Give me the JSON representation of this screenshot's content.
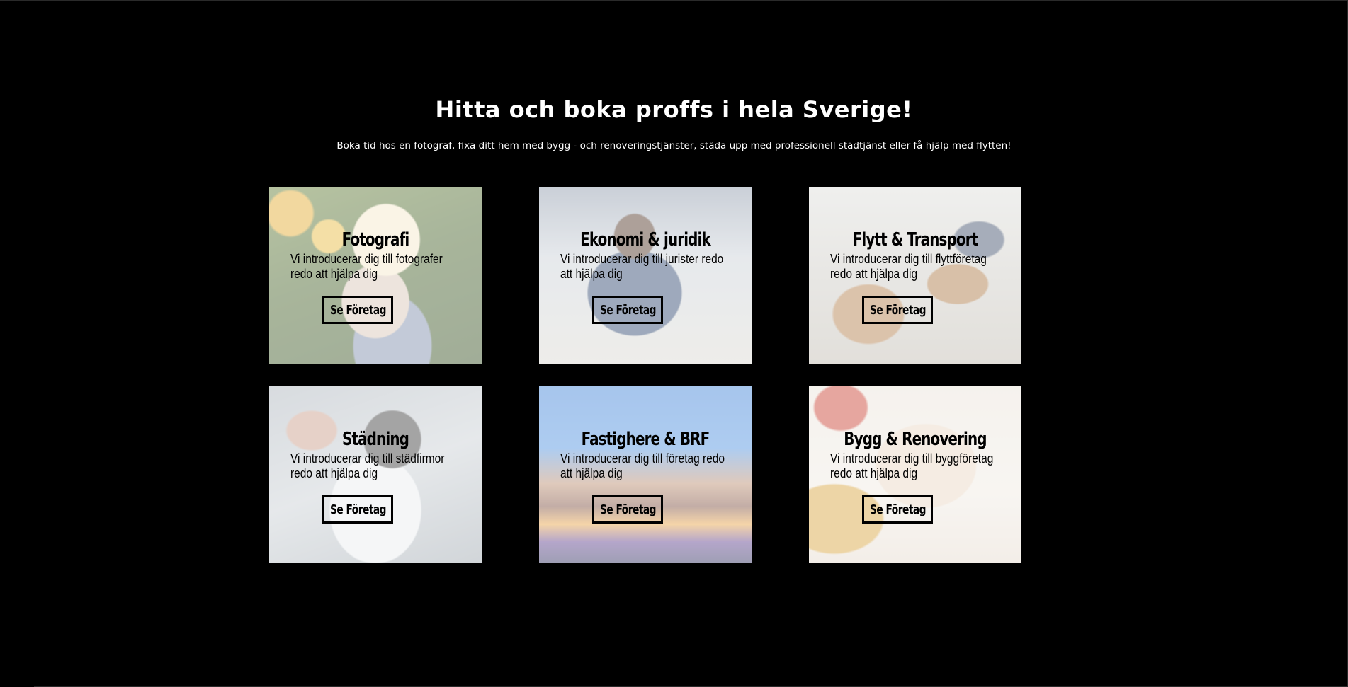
{
  "hero": {
    "title": "Hitta och boka proffs i hela Sverige!",
    "subtitle": "Boka tid hos en fotograf, fixa ditt hem med bygg - och renoveringstjänster, städa upp med professionell städtjänst eller få hjälp med flytten!"
  },
  "cards": [
    {
      "title": "Fotografi",
      "desc_line1": "Vi introducerar dig till fotografer",
      "desc_line2": "redo att hjälpa dig",
      "button": "Se Företag"
    },
    {
      "title": "Ekonomi & juridik",
      "desc_line1": "Vi introducerar dig till jurister redo",
      "desc_line2": "att hjälpa dig",
      "button": "Se Företag"
    },
    {
      "title": "Flytt & Transport",
      "desc_line1": "Vi introducerar dig till flyttföretag",
      "desc_line2": "redo att hjälpa dig",
      "button": "Se Företag"
    },
    {
      "title": "Städning",
      "desc_line1": "Vi introducerar dig till städfirmor",
      "desc_line2": "redo att hjälpa dig",
      "button": "Se Företag"
    },
    {
      "title": "Fastighere & BRF",
      "desc_line1": "Vi introducerar dig till företag redo",
      "desc_line2": "att hjälpa dig",
      "button": "Se Företag"
    },
    {
      "title": "Bygg & Renovering",
      "desc_line1": "Vi introducerar dig till byggföretag",
      "desc_line2": "redo att hjälpa dig",
      "button": "Se Företag"
    }
  ],
  "colors": {
    "background": "#000000",
    "text": "#ffffff",
    "card_text": "#000000"
  }
}
